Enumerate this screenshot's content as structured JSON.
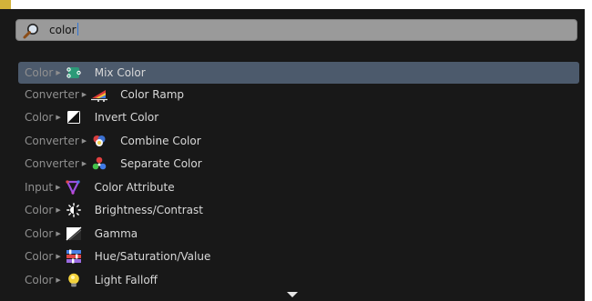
{
  "search": {
    "query": "color"
  },
  "results": [
    {
      "category": "Color",
      "label": "Mix Color",
      "icon": "mix-color-icon",
      "selected": true
    },
    {
      "category": "Converter",
      "label": "Color Ramp",
      "icon": "color-ramp-icon"
    },
    {
      "category": "Color",
      "label": "Invert Color",
      "icon": "invert-color-icon"
    },
    {
      "category": "Converter",
      "label": "Combine Color",
      "icon": "combine-color-icon"
    },
    {
      "category": "Converter",
      "label": "Separate Color",
      "icon": "separate-color-icon"
    },
    {
      "category": "Input",
      "label": "Color Attribute",
      "icon": "color-attribute-icon"
    },
    {
      "category": "Color",
      "label": "Brightness/Contrast",
      "icon": "brightness-contrast-icon"
    },
    {
      "category": "Color",
      "label": "Gamma",
      "icon": "gamma-icon"
    },
    {
      "category": "Color",
      "label": "Hue/Saturation/Value",
      "icon": "hue-saturation-value-icon"
    },
    {
      "category": "Color",
      "label": "Light Falloff",
      "icon": "light-falloff-icon"
    }
  ],
  "colors": {
    "panel_bg": "#181818",
    "search_bg": "#9a9a9a",
    "selected_row": "#4c5a6c",
    "category_text": "#8f8f8f",
    "label_text": "#d8d8d8",
    "caret": "#2f74d6"
  }
}
